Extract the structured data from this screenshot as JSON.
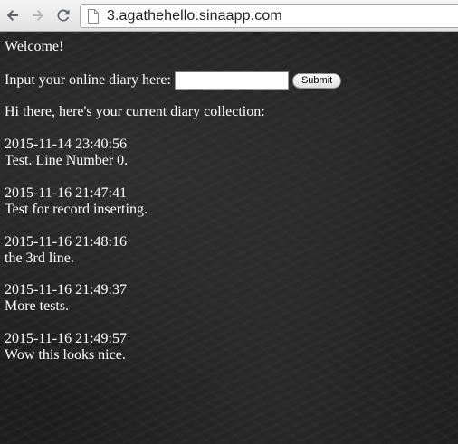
{
  "browser": {
    "url": "3.agathehello.sinaapp.com"
  },
  "page": {
    "welcome": "Welcome!",
    "input_label": "Input your online diary here:",
    "input_value": "",
    "submit_label": "Submit",
    "collection_heading": "Hi there, here's your current diary collection:",
    "entries": [
      {
        "date": "2015-11-14 23:40:56",
        "text": "Test. Line Number 0."
      },
      {
        "date": "2015-11-16 21:47:41",
        "text": "Test for record inserting."
      },
      {
        "date": "2015-11-16 21:48:16",
        "text": "the 3rd line."
      },
      {
        "date": "2015-11-16 21:49:37",
        "text": "More tests."
      },
      {
        "date": "2015-11-16 21:49:57",
        "text": "Wow this looks nice."
      }
    ]
  }
}
